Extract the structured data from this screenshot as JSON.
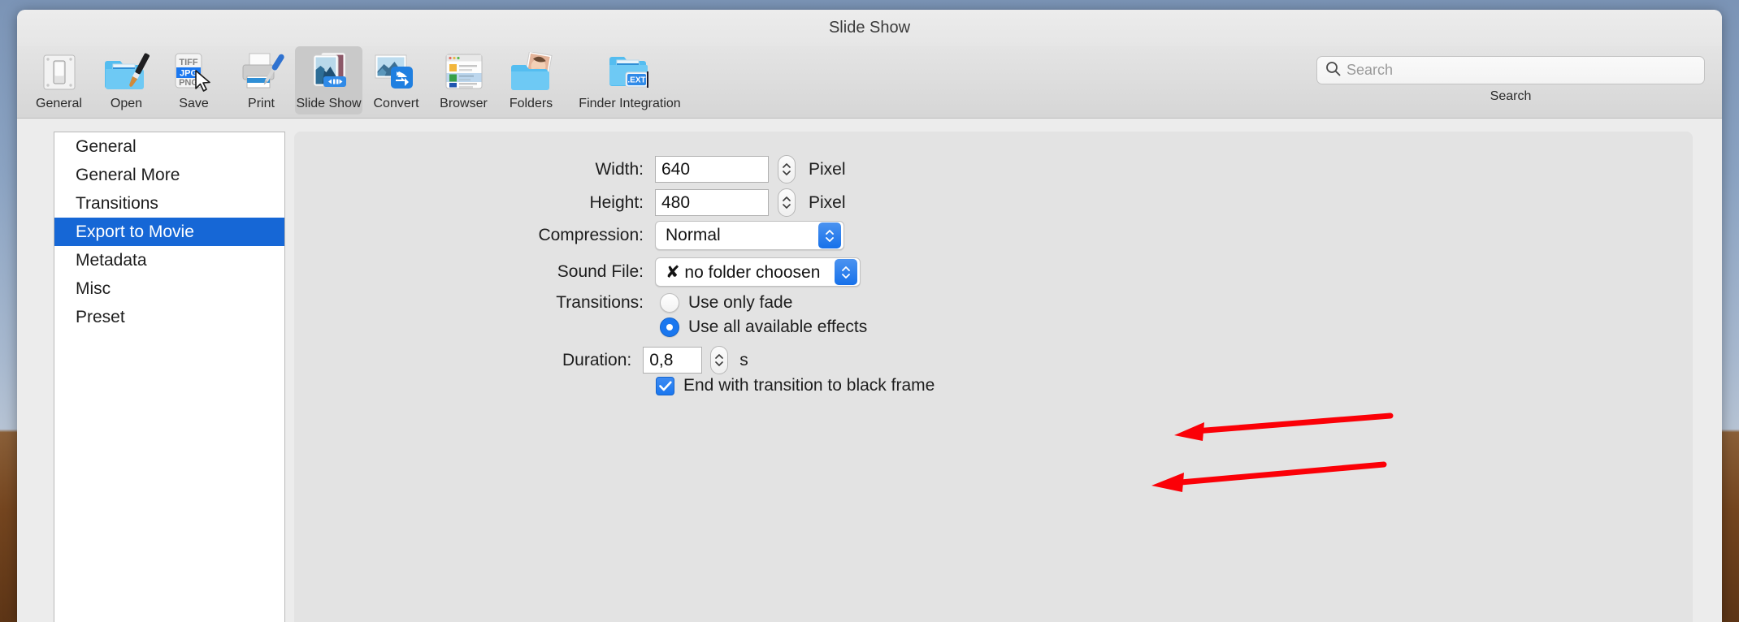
{
  "window": {
    "title": "Slide Show"
  },
  "toolbar": {
    "items": [
      {
        "label": "General",
        "icon": "switch-icon",
        "selected": false
      },
      {
        "label": "Open",
        "icon": "folder-brush-icon",
        "selected": false
      },
      {
        "label": "Save",
        "icon": "file-formats-icon",
        "selected": false
      },
      {
        "label": "Print",
        "icon": "printer-icon",
        "selected": false
      },
      {
        "label": "Slide Show",
        "icon": "slideshow-icon",
        "selected": true
      },
      {
        "label": "Convert",
        "icon": "convert-icon",
        "selected": false
      },
      {
        "label": "Browser",
        "icon": "browser-window-icon",
        "selected": false
      },
      {
        "label": "Folders",
        "icon": "folder-photos-icon",
        "selected": false
      },
      {
        "label": "Finder Integration",
        "icon": "folder-ext-icon",
        "selected": false
      }
    ],
    "save_icon_formats": [
      "TIFF",
      "JPG",
      "PNG"
    ],
    "finder_ext_badge": ".EXT"
  },
  "search": {
    "placeholder": "Search",
    "value": "",
    "caption": "Search",
    "icon": "search-icon"
  },
  "sidebar": {
    "items": [
      {
        "label": "General",
        "active": false
      },
      {
        "label": "General More",
        "active": false
      },
      {
        "label": "Transitions",
        "active": false
      },
      {
        "label": "Export to Movie",
        "active": true
      },
      {
        "label": "Metadata",
        "active": false
      },
      {
        "label": "Misc",
        "active": false
      },
      {
        "label": "Preset",
        "active": false
      }
    ]
  },
  "form": {
    "width": {
      "label": "Width:",
      "value": "640",
      "unit": "Pixel"
    },
    "height": {
      "label": "Height:",
      "value": "480",
      "unit": "Pixel"
    },
    "compression": {
      "label": "Compression:",
      "value": "Normal"
    },
    "sound_file": {
      "label": "Sound File:",
      "value": "✘ no folder choosen"
    },
    "transitions": {
      "label": "Transitions:",
      "options": [
        {
          "label": "Use only fade",
          "selected": false
        },
        {
          "label": "Use all available effects",
          "selected": true
        }
      ]
    },
    "duration": {
      "label": "Duration:",
      "value": "0,8",
      "unit": "s"
    },
    "end_black_frame": {
      "label": "End with transition to black frame",
      "checked": true
    }
  },
  "colors": {
    "accent": "#1667d6",
    "popup_arrow_blue": "#1771ea",
    "annotation_red": "#fb0007",
    "window_bg": "#ececec",
    "panel_bg": "#e3e3e3"
  },
  "annotations": [
    {
      "name": "arrow-to-use-all-available-effects"
    },
    {
      "name": "arrow-to-duration"
    }
  ]
}
